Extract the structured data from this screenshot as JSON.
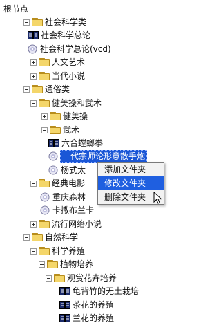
{
  "tree": {
    "root_label": "根节点",
    "nodes": [
      {
        "label": "社会科学类",
        "icon": "folder",
        "toggle": "minus"
      },
      {
        "label": "社会科学总论",
        "icon": "book",
        "toggle": "none"
      },
      {
        "label": "社会科学总论(vcd)",
        "icon": "disc",
        "toggle": "none"
      },
      {
        "label": "人文艺术",
        "icon": "folder",
        "toggle": "plus"
      },
      {
        "label": "当代小说",
        "icon": "folder",
        "toggle": "plus"
      },
      {
        "label": "通俗类",
        "icon": "folder",
        "toggle": "minus"
      },
      {
        "label": "健美操和武术",
        "icon": "folder",
        "toggle": "minus"
      },
      {
        "label": "健美操",
        "icon": "folder",
        "toggle": "plus"
      },
      {
        "label": "武术",
        "icon": "folder",
        "toggle": "minus"
      },
      {
        "label": "六合螳螂拳",
        "icon": "book",
        "toggle": "none"
      },
      {
        "label": "一代宗师论形意散手炮",
        "icon": "disc",
        "toggle": "none",
        "selected": true
      },
      {
        "label": "杨式太",
        "icon": "disc",
        "toggle": "none"
      },
      {
        "label": "经典电影",
        "icon": "folder",
        "toggle": "minus"
      },
      {
        "label": "重庆森林",
        "icon": "disc",
        "toggle": "none"
      },
      {
        "label": "卡撒布兰卡",
        "icon": "disc",
        "toggle": "none"
      },
      {
        "label": "流行网络小说",
        "icon": "folder",
        "toggle": "plus"
      },
      {
        "label": "自然科学",
        "icon": "folder",
        "toggle": "minus"
      },
      {
        "label": "科学养殖",
        "icon": "folder",
        "toggle": "minus"
      },
      {
        "label": "植物培养",
        "icon": "folder",
        "toggle": "minus"
      },
      {
        "label": "观赏花卉培养",
        "icon": "folder",
        "toggle": "minus"
      },
      {
        "label": "龟背竹的无土栽培",
        "icon": "book",
        "toggle": "none"
      },
      {
        "label": "茶花的养殖",
        "icon": "book",
        "toggle": "none"
      },
      {
        "label": "兰花的养殖",
        "icon": "book",
        "toggle": "none"
      }
    ]
  },
  "context_menu": {
    "items": [
      {
        "label": "添加文件夹",
        "highlighted": false
      },
      {
        "label": "修改文件夹",
        "highlighted": true
      },
      {
        "label": "删除文件夹",
        "highlighted": false
      }
    ]
  },
  "colors": {
    "selection": "#1a56d6",
    "menu_highlight": "#1f5fe0",
    "folder": "#f4d66a"
  }
}
